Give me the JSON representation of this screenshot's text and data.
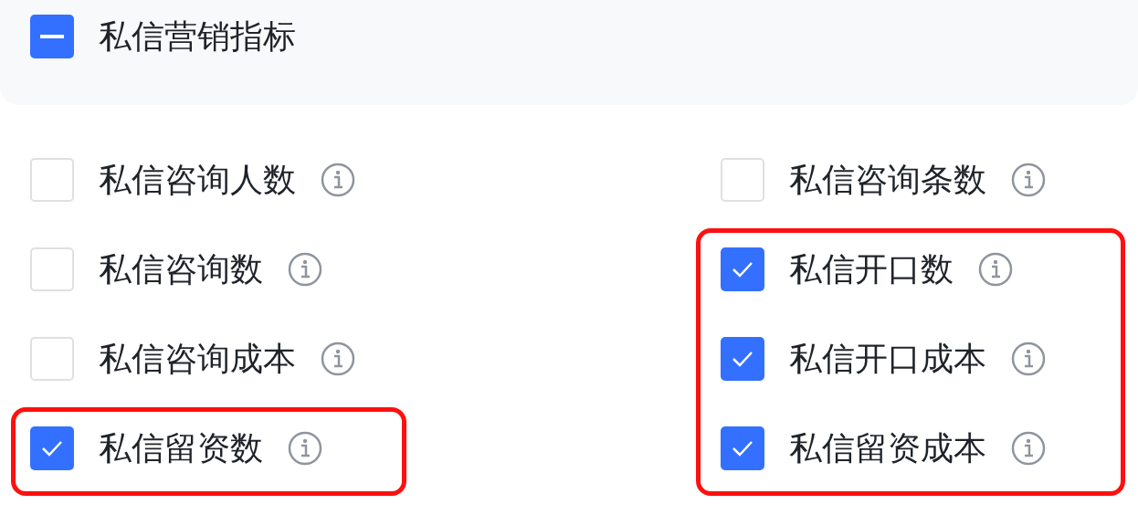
{
  "header": {
    "label": "私信营销指标",
    "checked": false,
    "indeterminate": true
  },
  "columns": [
    {
      "items": [
        {
          "label": "私信咨询人数",
          "checked": false,
          "highlighted": false
        },
        {
          "label": "私信咨询数",
          "checked": false,
          "highlighted": false
        },
        {
          "label": "私信咨询成本",
          "checked": false,
          "highlighted": false
        },
        {
          "label": "私信留资数",
          "checked": true,
          "highlighted": true
        }
      ]
    },
    {
      "items": [
        {
          "label": "私信咨询条数",
          "checked": false,
          "highlighted": false
        },
        {
          "label": "私信开口数",
          "checked": true,
          "highlighted": true
        },
        {
          "label": "私信开口成本",
          "checked": true,
          "highlighted": true
        },
        {
          "label": "私信留资成本",
          "checked": true,
          "highlighted": true
        }
      ]
    }
  ]
}
